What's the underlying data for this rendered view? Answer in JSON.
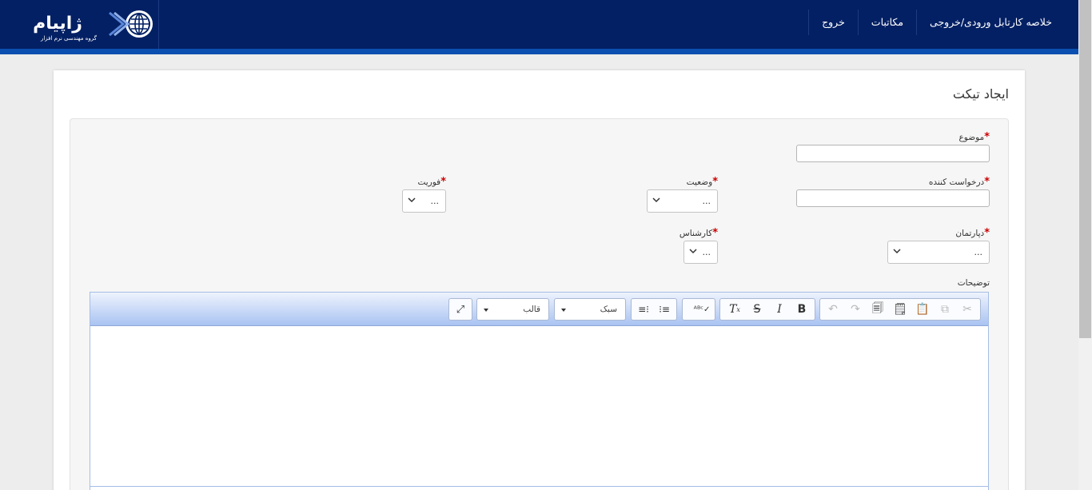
{
  "header": {
    "logo_text": "ژاپیام",
    "logo_subtitle": "گروه مهندسی نرم افزار",
    "nav": [
      {
        "label": "خلاصه کارتابل ورودی/خروجی"
      },
      {
        "label": "مکاتبات"
      },
      {
        "label": "خروج"
      }
    ]
  },
  "page": {
    "title": "ایجاد تیکت"
  },
  "form": {
    "subject_label": "موضوع",
    "requester_label": "درخواست کننده",
    "status_label": "وضعیت",
    "status_value": "...",
    "priority_label": "فوریت",
    "priority_value": "...",
    "department_label": "دپارتمان",
    "department_value": "...",
    "expert_label": "کارشناس",
    "expert_value": "...",
    "description_label": "توضیحات",
    "required_mark": "*"
  },
  "editor": {
    "style_combo": "سبک",
    "template_combo": "قالب",
    "buttons": [
      "cut",
      "copy",
      "paste",
      "paste-text",
      "paste-word",
      "undo",
      "redo",
      "bold",
      "italic",
      "strike",
      "remove-format",
      "spellcheck",
      "ltr",
      "rtl",
      "maximize"
    ]
  }
}
